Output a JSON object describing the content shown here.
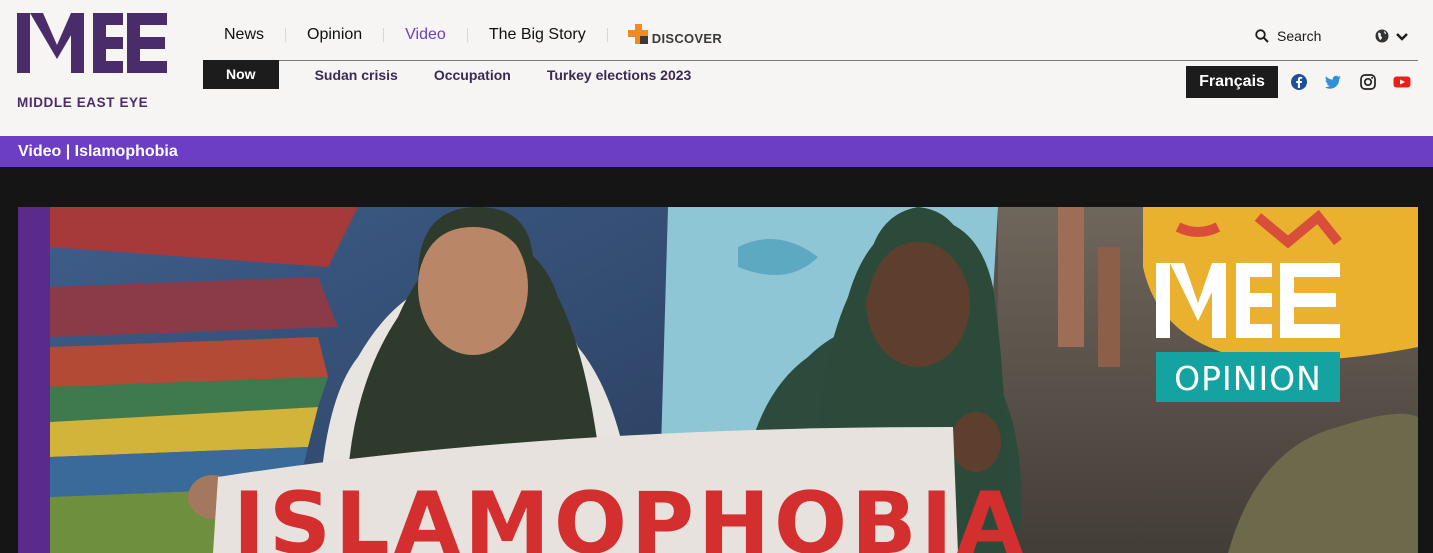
{
  "site": {
    "logo_text": "MIDDLE EAST EYE",
    "logo_mark": "MEE",
    "brand_color": "#6b3ec4"
  },
  "nav": {
    "items": [
      {
        "label": "News"
      },
      {
        "label": "Opinion"
      },
      {
        "label": "Video"
      },
      {
        "label": "The Big Story"
      }
    ],
    "discover_label": "DISCOVER",
    "active_item": "Video"
  },
  "subnav": {
    "now_label": "Now",
    "items": [
      {
        "label": "Sudan crisis"
      },
      {
        "label": "Occupation"
      },
      {
        "label": "Turkey elections 2023"
      }
    ]
  },
  "header_tools": {
    "search_label": "Search",
    "language_button": "Français",
    "icons": [
      "search-icon",
      "globe-icon",
      "chevron-down-icon",
      "facebook-icon",
      "twitter-icon",
      "instagram-icon",
      "youtube-icon"
    ]
  },
  "breadcrumb": {
    "text": "Video | Islamophobia"
  },
  "hero": {
    "banner_text": "ISLAMOPHOBIA",
    "overlay_logo": "MEE",
    "overlay_label": "OPINION"
  }
}
